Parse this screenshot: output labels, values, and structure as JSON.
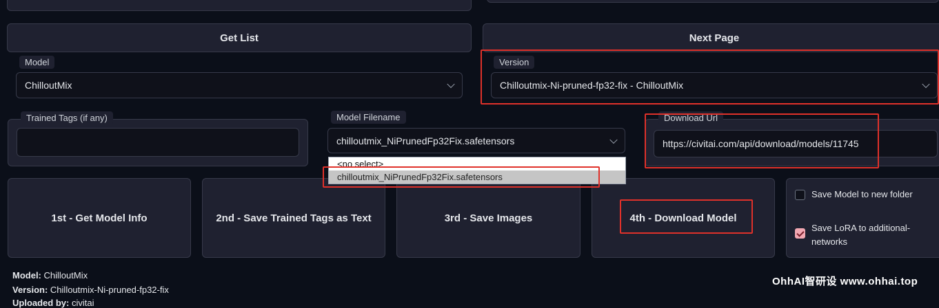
{
  "buttons": {
    "get_list": "Get List",
    "next_page": "Next Page",
    "step1": "1st - Get Model Info",
    "step2": "2nd - Save Trained Tags as Text",
    "step3": "3rd - Save Images",
    "step4": "4th - Download Model"
  },
  "model": {
    "label": "Model",
    "value": "ChilloutMix"
  },
  "version": {
    "label": "Version",
    "value": "Chilloutmix-Ni-pruned-fp32-fix - ChilloutMix"
  },
  "trained_tags": {
    "label": "Trained Tags (if any)",
    "value": ""
  },
  "model_filename": {
    "label": "Model Filename",
    "value": "chilloutmix_NiPrunedFp32Fix.safetensors",
    "options": [
      "<no select>",
      "chilloutmix_NiPrunedFp32Fix.safetensors"
    ]
  },
  "download_url": {
    "label": "Download Url",
    "value": "https://civitai.com/api/download/models/11745"
  },
  "checkboxes": {
    "save_model_new_folder": {
      "label": "Save Model to new folder",
      "checked": false
    },
    "save_lora_additional": {
      "label_line1": "Save LoRA to additional-",
      "label_line2": "networks",
      "checked": true
    }
  },
  "info": {
    "model_key": "Model:",
    "model_val": "ChilloutMix",
    "version_key": "Version:",
    "version_val": "Chilloutmix-Ni-pruned-fp32-fix",
    "uploaded_key": "Uploaded by:",
    "uploaded_val": "civitai"
  },
  "watermark": "OhhAI智研设 www.ohhai.top"
}
